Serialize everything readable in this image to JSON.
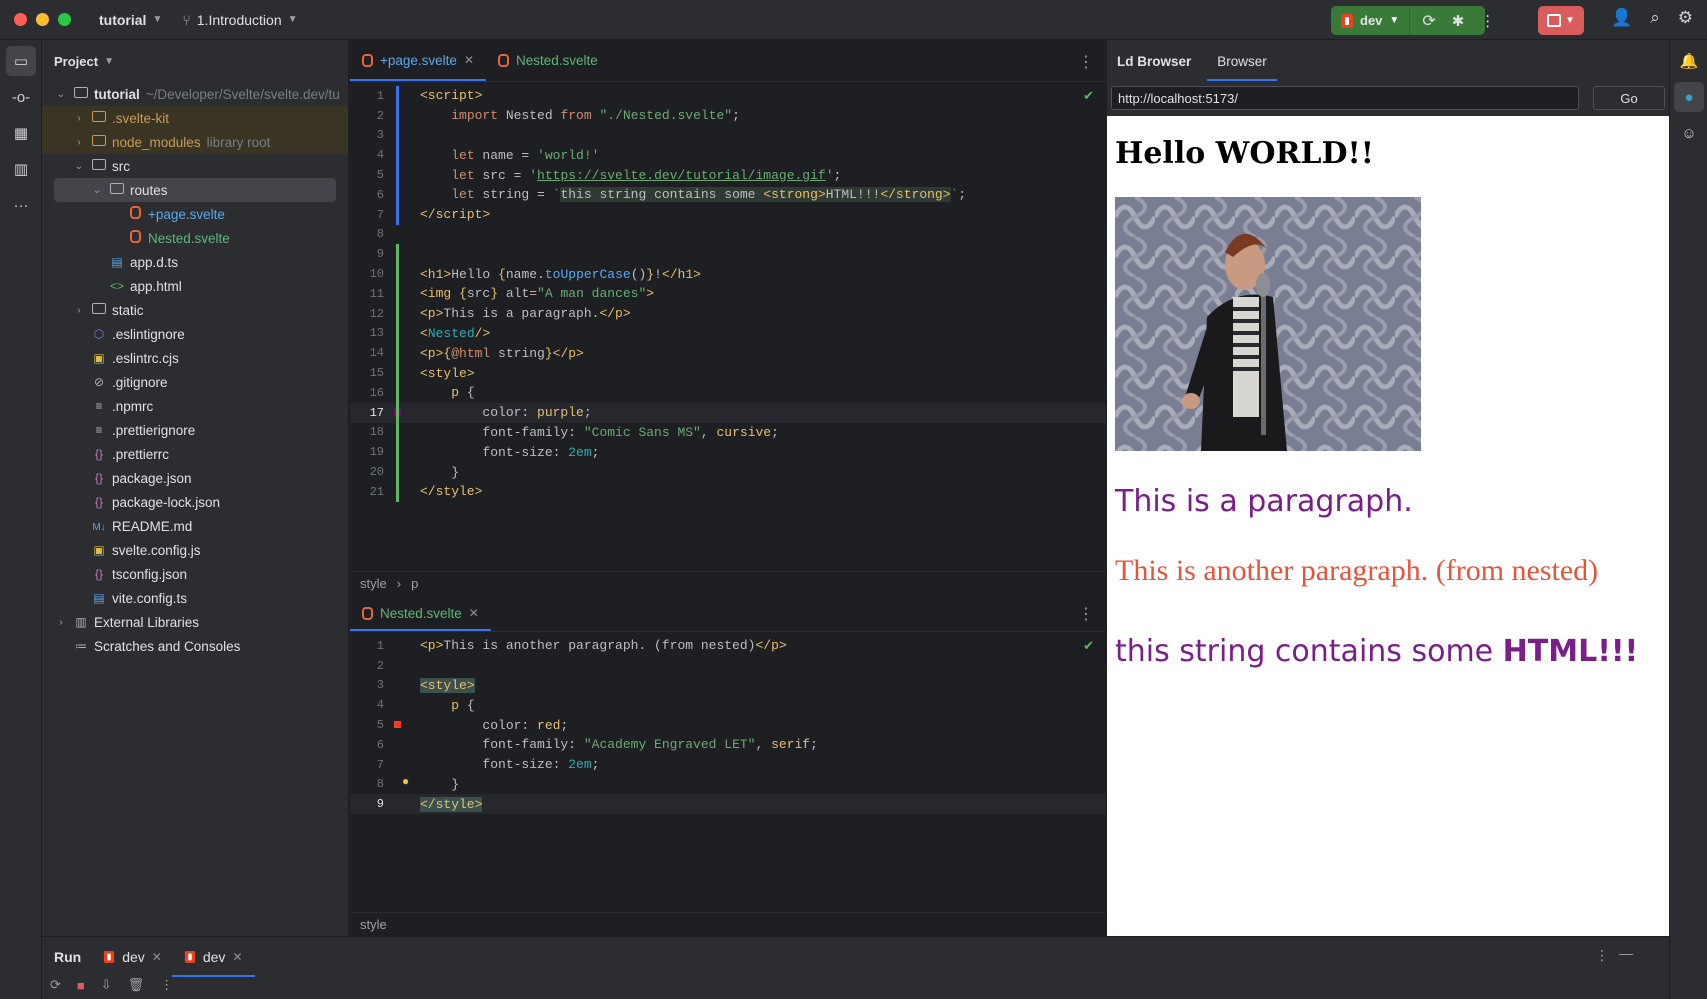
{
  "titlebar": {
    "project_name": "tutorial",
    "branch": "1.Introduction",
    "run_config": "dev"
  },
  "project_panel": {
    "title": "Project",
    "tree": [
      {
        "label": "tutorial",
        "extra": "~/Developer/Svelte/svelte.dev/tu",
        "indent": 0,
        "arrow": "down",
        "kind": "folder",
        "bold": true
      },
      {
        "label": ".svelte-kit",
        "extra": "",
        "indent": 1,
        "arrow": "right",
        "kind": "folder-excluded"
      },
      {
        "label": "node_modules",
        "extra": "library root",
        "indent": 1,
        "arrow": "right",
        "kind": "folder-excluded"
      },
      {
        "label": "src",
        "extra": "",
        "indent": 1,
        "arrow": "down",
        "kind": "folder"
      },
      {
        "label": "routes",
        "extra": "",
        "indent": 2,
        "arrow": "down",
        "kind": "folder-selected"
      },
      {
        "label": "+page.svelte",
        "extra": "",
        "indent": 3,
        "arrow": "",
        "kind": "svelte-blue"
      },
      {
        "label": "Nested.svelte",
        "extra": "",
        "indent": 3,
        "arrow": "",
        "kind": "svelte-green"
      },
      {
        "label": "app.d.ts",
        "extra": "",
        "indent": 2,
        "arrow": "",
        "kind": "ts"
      },
      {
        "label": "app.html",
        "extra": "",
        "indent": 2,
        "arrow": "",
        "kind": "html"
      },
      {
        "label": "static",
        "extra": "",
        "indent": 1,
        "arrow": "right",
        "kind": "folder"
      },
      {
        "label": ".eslintignore",
        "extra": "",
        "indent": 1,
        "arrow": "",
        "kind": "eslint"
      },
      {
        "label": ".eslintrc.cjs",
        "extra": "",
        "indent": 1,
        "arrow": "",
        "kind": "js"
      },
      {
        "label": ".gitignore",
        "extra": "",
        "indent": 1,
        "arrow": "",
        "kind": "gitignore"
      },
      {
        "label": ".npmrc",
        "extra": "",
        "indent": 1,
        "arrow": "",
        "kind": "text"
      },
      {
        "label": ".prettierignore",
        "extra": "",
        "indent": 1,
        "arrow": "",
        "kind": "text"
      },
      {
        "label": ".prettierrc",
        "extra": "",
        "indent": 1,
        "arrow": "",
        "kind": "json"
      },
      {
        "label": "package.json",
        "extra": "",
        "indent": 1,
        "arrow": "",
        "kind": "json"
      },
      {
        "label": "package-lock.json",
        "extra": "",
        "indent": 1,
        "arrow": "",
        "kind": "json"
      },
      {
        "label": "README.md",
        "extra": "",
        "indent": 1,
        "arrow": "",
        "kind": "md"
      },
      {
        "label": "svelte.config.js",
        "extra": "",
        "indent": 1,
        "arrow": "",
        "kind": "js"
      },
      {
        "label": "tsconfig.json",
        "extra": "",
        "indent": 1,
        "arrow": "",
        "kind": "json"
      },
      {
        "label": "vite.config.ts",
        "extra": "",
        "indent": 1,
        "arrow": "",
        "kind": "ts"
      },
      {
        "label": "External Libraries",
        "extra": "",
        "indent": 0,
        "arrow": "right",
        "kind": "lib"
      },
      {
        "label": "Scratches and Consoles",
        "extra": "",
        "indent": 0,
        "arrow": "",
        "kind": "scratch"
      }
    ]
  },
  "editor_top": {
    "tabs": [
      {
        "label": "+page.svelte",
        "active": true,
        "closable": true
      },
      {
        "label": "Nested.svelte",
        "active": false,
        "closable": false
      }
    ],
    "breadcrumb": [
      "style",
      "p"
    ],
    "current_line": 17
  },
  "editor_bottom": {
    "tabs": [
      {
        "label": "Nested.svelte",
        "active": true,
        "closable": true
      }
    ],
    "breadcrumb": [
      "style"
    ],
    "current_line": 9
  },
  "browser": {
    "tabs": [
      "Ld Browser",
      "Browser"
    ],
    "url": "http://localhost:5173/",
    "go_label": "Go",
    "heading": "Hello WORLD!!",
    "image_alt": "A man dances",
    "para1": "This is a paragraph.",
    "para2": "This is another paragraph. (from nested)",
    "para3_prefix": "this string contains some ",
    "para3_strong": "HTML!!!"
  },
  "run_panel": {
    "title": "Run",
    "tabs": [
      {
        "label": "dev",
        "active": false
      },
      {
        "label": "dev",
        "active": true
      }
    ]
  },
  "colors": {
    "run_green": "#3a7a38",
    "stop_red": "#db5c5c",
    "accent_blue": "#3574f0",
    "paragraph_purple": "#7a1e8a",
    "nested_red": "#e8543a"
  }
}
